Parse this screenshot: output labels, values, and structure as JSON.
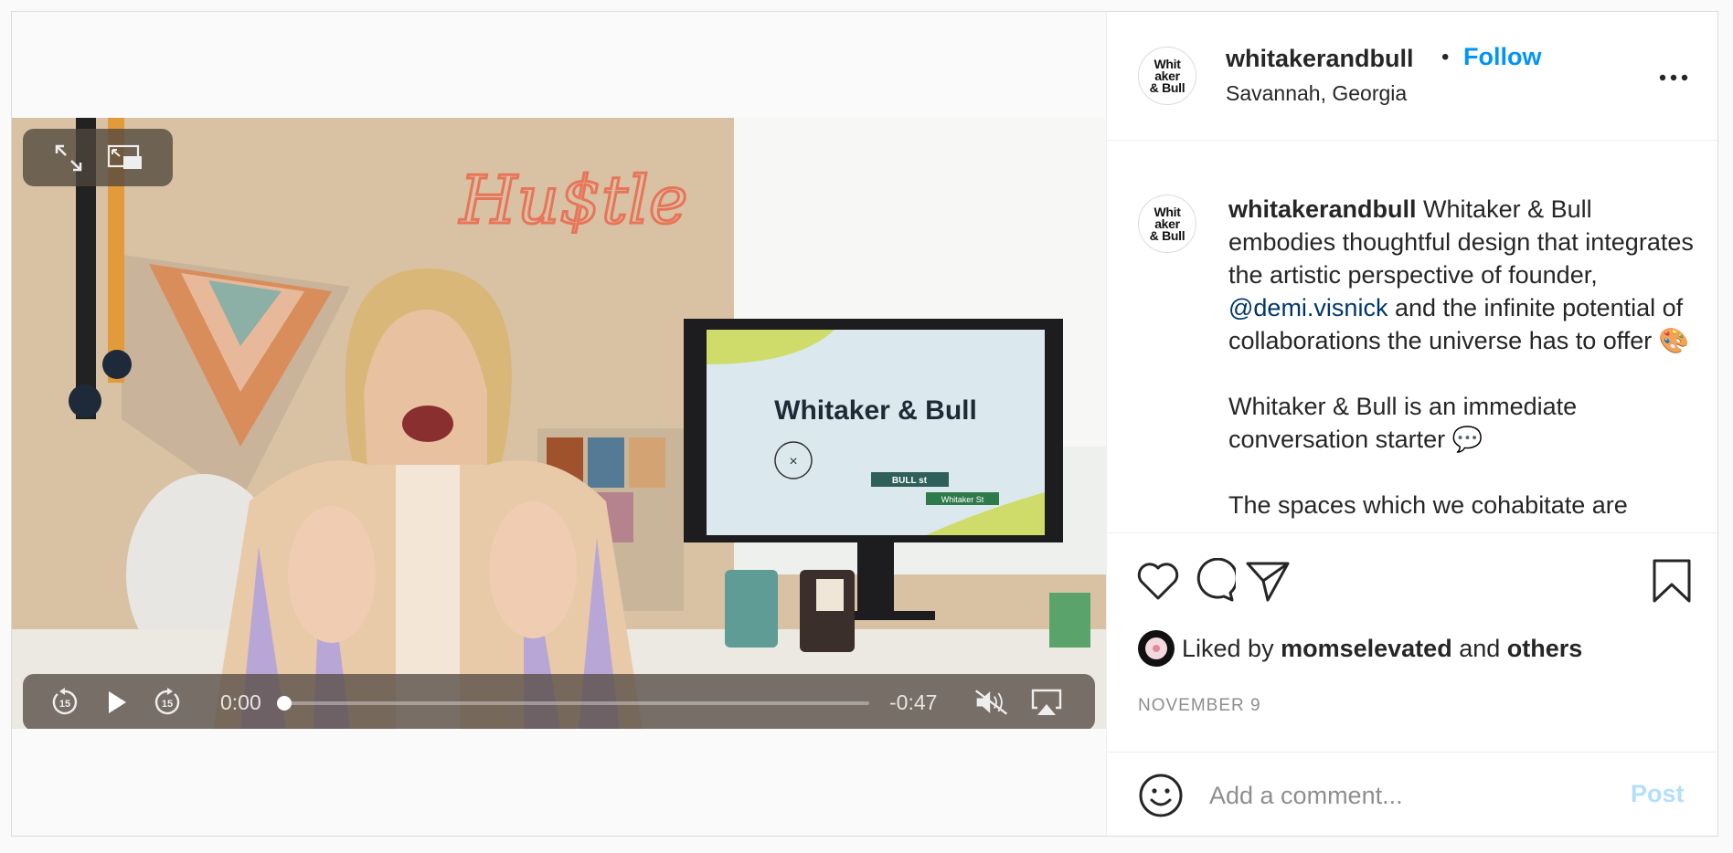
{
  "post": {
    "username": "whitakerandbull",
    "avatar_text": "Whit\naker\n& Bull",
    "separator": "•",
    "follow_label": "Follow",
    "location": "Savannah, Georgia",
    "more_icon": "more-horizontal-icon"
  },
  "video": {
    "current_time": "0:00",
    "remaining_time": "-0:47",
    "progress": 0,
    "muted": true,
    "controls": {
      "expand_icon": "expand-icon",
      "pip_icon": "picture-in-picture-icon",
      "rewind_icon": "rewind-15-icon",
      "play_icon": "play-icon",
      "forward_icon": "forward-15-icon",
      "mute_icon": "speaker-muted-icon",
      "airplay_icon": "airplay-icon"
    },
    "scene_text": {
      "neon_sign": "Hu$tle",
      "monitor_title": "Whitaker & Bull",
      "street_sign_1": "BULL st",
      "street_sign_2": "Whitaker St"
    }
  },
  "caption": {
    "username": "whitakerandbull",
    "part1": " Whitaker & Bull embodies thoughtful design that integrates the artistic perspective of founder, ",
    "mention": "@demi.visnick",
    "part2": " and the infinite potential of collaborations the universe has to offer 🎨",
    "paragraph2": "Whitaker & Bull is an immediate conversation starter 💬",
    "paragraph3": "The spaces which we cohabitate are"
  },
  "actions": {
    "like_icon": "heart-icon",
    "comment_icon": "comment-icon",
    "share_icon": "share-icon",
    "save_icon": "bookmark-icon"
  },
  "likes": {
    "prefix": "Liked by",
    "user": "momselevated",
    "conjunction": "and",
    "others": "others"
  },
  "date": "NOVEMBER 9",
  "comment": {
    "placeholder": "Add a comment...",
    "post_label": "Post",
    "emoji_icon": "smiley-icon"
  },
  "colors": {
    "accent": "#0095f6",
    "mention": "#00376b",
    "post_disabled": "#b2dffc"
  }
}
